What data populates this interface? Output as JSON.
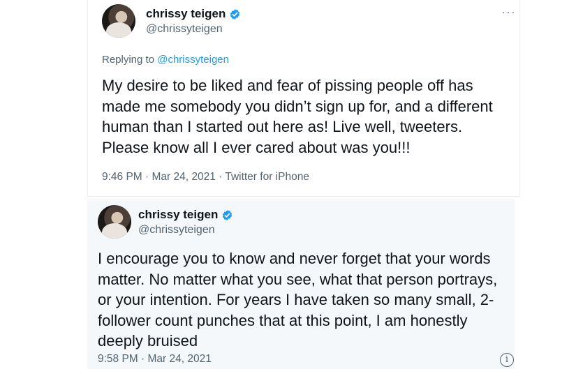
{
  "tweet1": {
    "name": "chrissy teigen",
    "handle": "@chrissyteigen",
    "replying_prefix": "Replying to ",
    "replying_handle": "@chrissyteigen",
    "text": "My desire to be liked and fear of pissing people off has\nmade me somebody you didn’t sign up for, and a different\nhuman than I started out here as! Live well, tweeters.\nPlease know all I ever cared about was you!!!",
    "timestamp": "9:46 PM · Mar 24, 2021 · Twitter for iPhone",
    "more_icon": "more-horizontal-icon"
  },
  "tweet2": {
    "name": "chrissy teigen",
    "handle": "@chrissyteigen",
    "text": "I encourage you to know and never forget that your words\nmatter. No matter what you see, what that person portrays,\nor your intention. For years I have taken so many small, 2-\nfollower count punches that at this point, I am honestly\ndeeply bruised",
    "timestamp": "9:58 PM · Mar 24, 2021",
    "info_icon": "info-icon"
  },
  "colors": {
    "verified_blue": "#1d9bf0",
    "link_blue": "#1d9bf0",
    "secondary_text": "#536471",
    "embed_background": "#f5f8fa"
  }
}
